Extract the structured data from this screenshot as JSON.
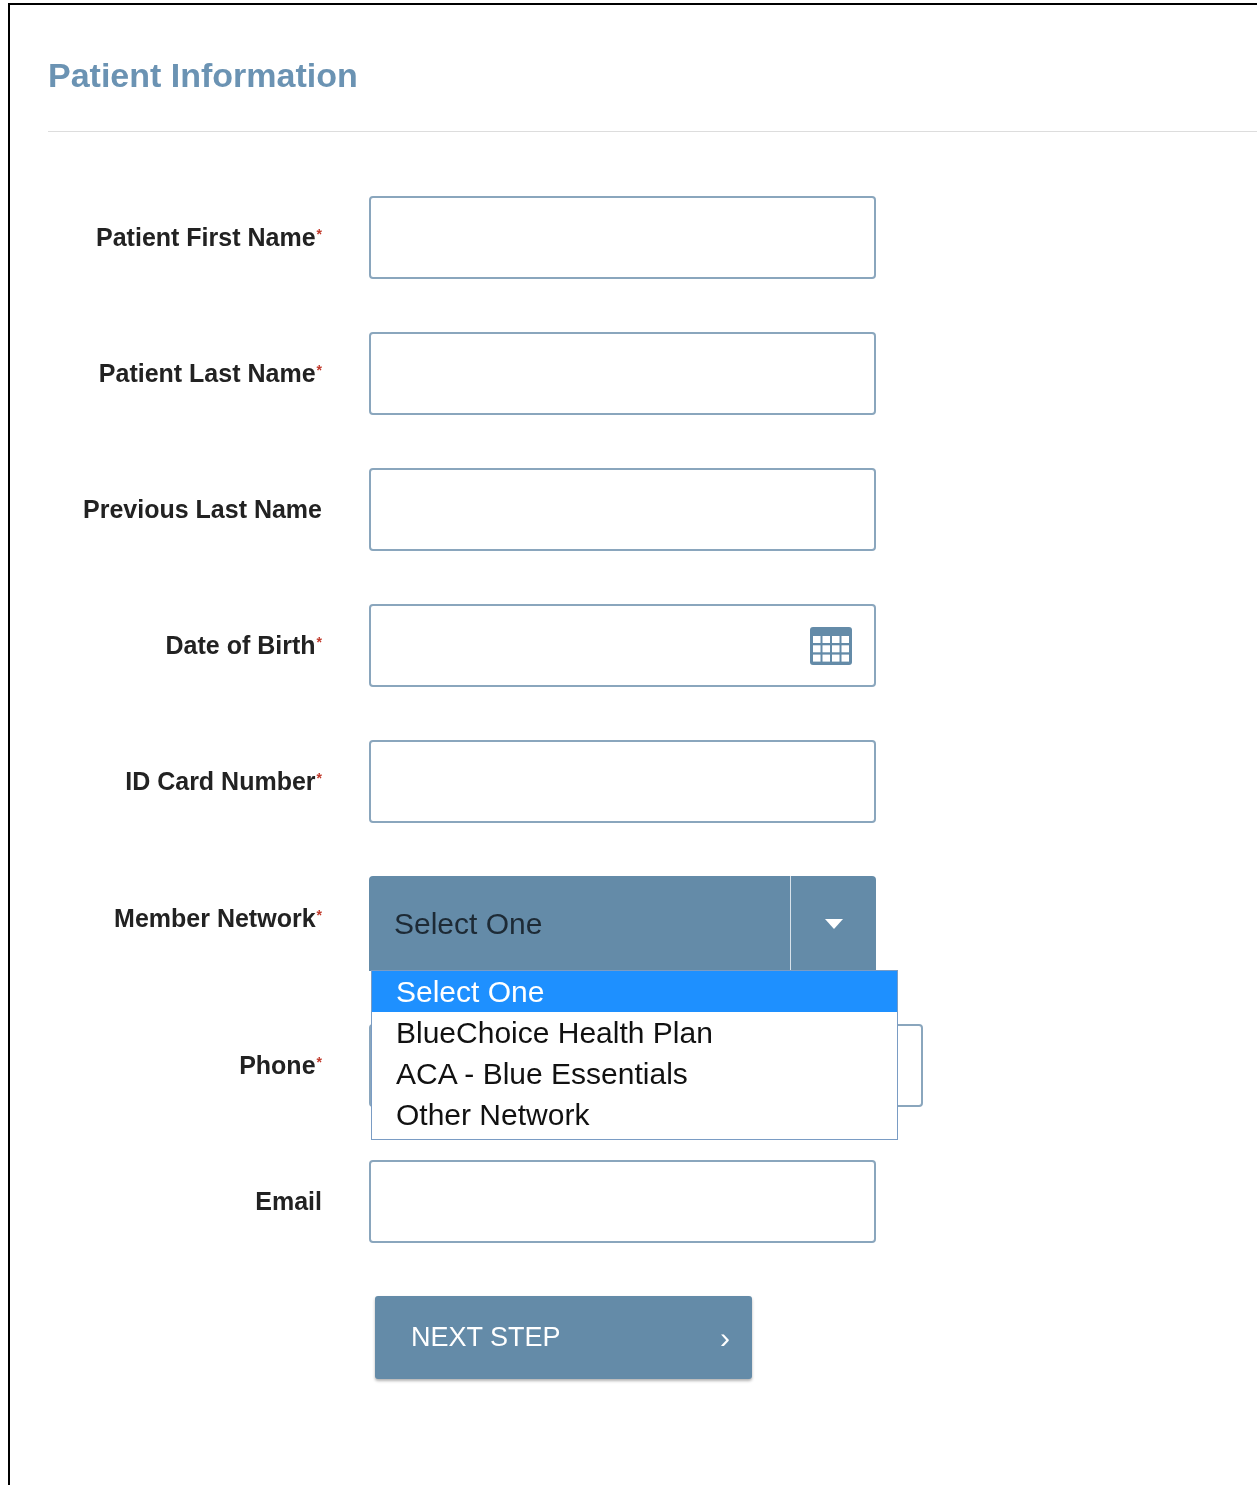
{
  "title": "Patient Information",
  "fields": [
    {
      "kind": "text",
      "label": "Patient First Name",
      "mark": "*"
    },
    {
      "kind": "text",
      "label": "Patient Last Name",
      "mark": "*"
    },
    {
      "kind": "text",
      "label": "Previous Last Name"
    },
    {
      "kind": "date",
      "label": "Date of Birth",
      "mark": "*"
    },
    {
      "kind": "text",
      "label": "ID Card Number",
      "mark": "*"
    },
    {
      "kind": "select",
      "label": "Member Network",
      "mark": "*",
      "value": "Select One",
      "expanded": true,
      "options": [
        {
          "label": "Select One",
          "selected": true
        },
        {
          "label": "BlueChoice Health Plan",
          "selected": false
        },
        {
          "label": "ACA - Blue Essentials",
          "selected": false
        },
        {
          "label": "Other Network",
          "selected": false
        }
      ]
    },
    {
      "kind": "wide",
      "label": "Phone",
      "mark": "*"
    },
    {
      "kind": "text",
      "label": "Email"
    }
  ],
  "next_button": {
    "label": "NEXT STEP",
    "icon": "›"
  }
}
